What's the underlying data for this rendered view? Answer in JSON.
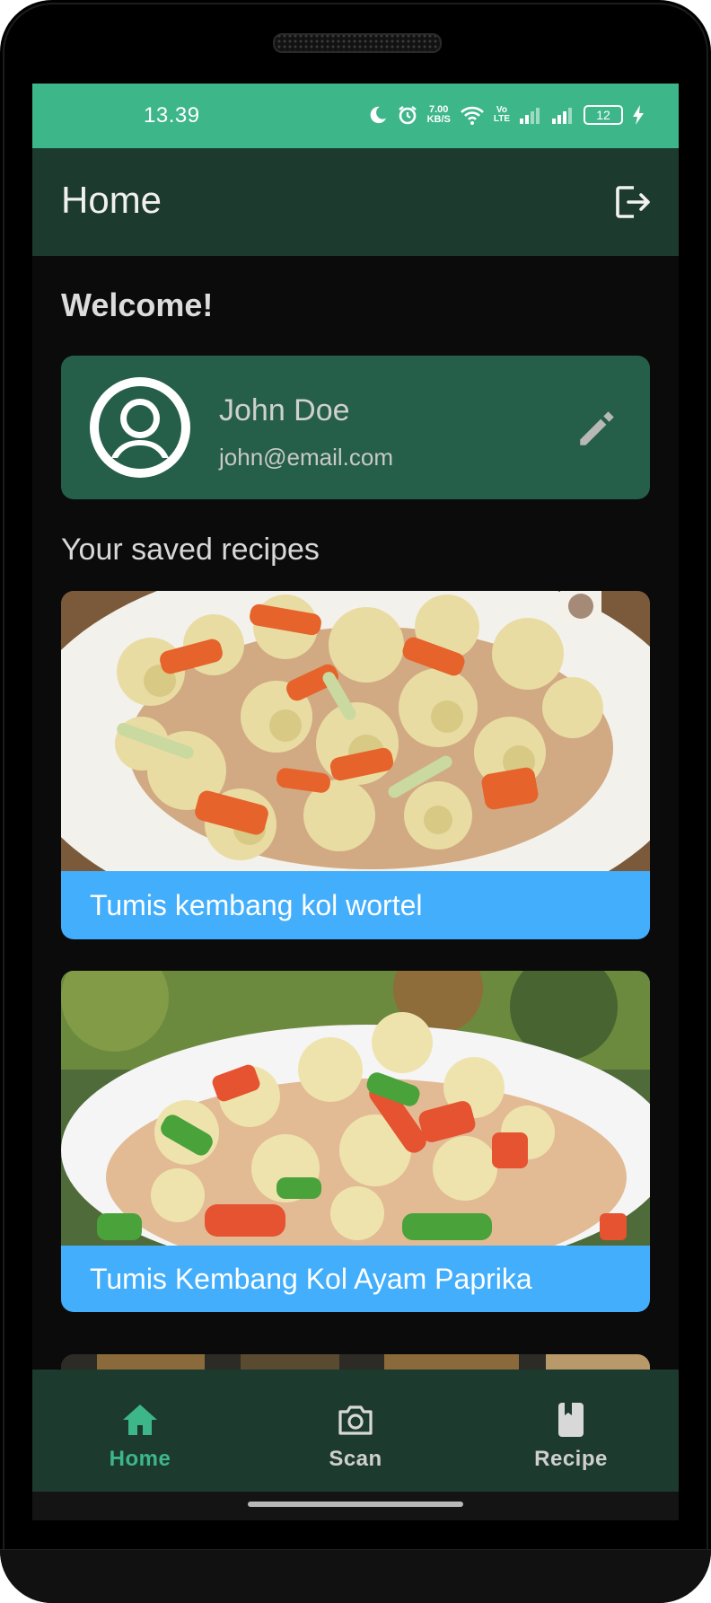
{
  "status_bar": {
    "time": "13.39",
    "network_speed_value": "7.00",
    "network_speed_unit": "KB/S",
    "volte_top": "Vo",
    "volte_bottom": "LTE",
    "battery": "12",
    "icons": [
      "moon-icon",
      "alarm-icon",
      "wifi-icon",
      "signal-icon",
      "signal-icon",
      "charging-icon"
    ],
    "bg_color": "#3db68a"
  },
  "app_bar": {
    "title": "Home",
    "logout_icon": "logout-icon",
    "bg_color": "#1d3a2f"
  },
  "welcome": "Welcome!",
  "profile": {
    "name": "John Doe",
    "email": "john@email.com",
    "avatar_icon": "person-icon",
    "edit_icon": "pencil-icon",
    "card_color": "#255f4a"
  },
  "saved_recipes": {
    "title": "Your saved recipes",
    "items": [
      {
        "name": "Tumis kembang kol wortel"
      },
      {
        "name": "Tumis Kembang Kol Ayam Paprika"
      }
    ],
    "label_color": "#42aefc"
  },
  "bottom_nav": {
    "items": [
      {
        "label": "Home",
        "icon": "home-icon",
        "active": true
      },
      {
        "label": "Scan",
        "icon": "camera-icon",
        "active": false
      },
      {
        "label": "Recipe",
        "icon": "book-icon",
        "active": false
      }
    ],
    "active_color": "#3db68a"
  }
}
